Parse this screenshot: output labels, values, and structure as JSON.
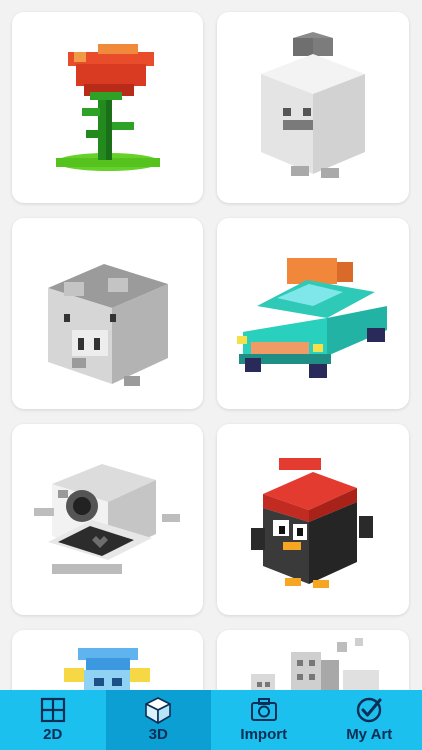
{
  "gallery": {
    "items": [
      {
        "name": "rose-voxel"
      },
      {
        "name": "ghost-voxel"
      },
      {
        "name": "pig-voxel"
      },
      {
        "name": "car-voxel"
      },
      {
        "name": "camera-voxel"
      },
      {
        "name": "penguin-voxel"
      },
      {
        "name": "character-voxel"
      },
      {
        "name": "city-voxel"
      }
    ]
  },
  "tabbar": {
    "tabs": [
      {
        "label": "2D",
        "icon": "grid-icon",
        "active": false
      },
      {
        "label": "3D",
        "icon": "cube-icon",
        "active": true
      },
      {
        "label": "Import",
        "icon": "camera-icon",
        "active": false
      },
      {
        "label": "My Art",
        "icon": "checkmark-circle-icon",
        "active": false
      }
    ]
  },
  "colors": {
    "tabbar_bg": "#1cc0ee",
    "tab_active_bg": "#0c9fd4",
    "tab_text": "#0a2e55"
  }
}
